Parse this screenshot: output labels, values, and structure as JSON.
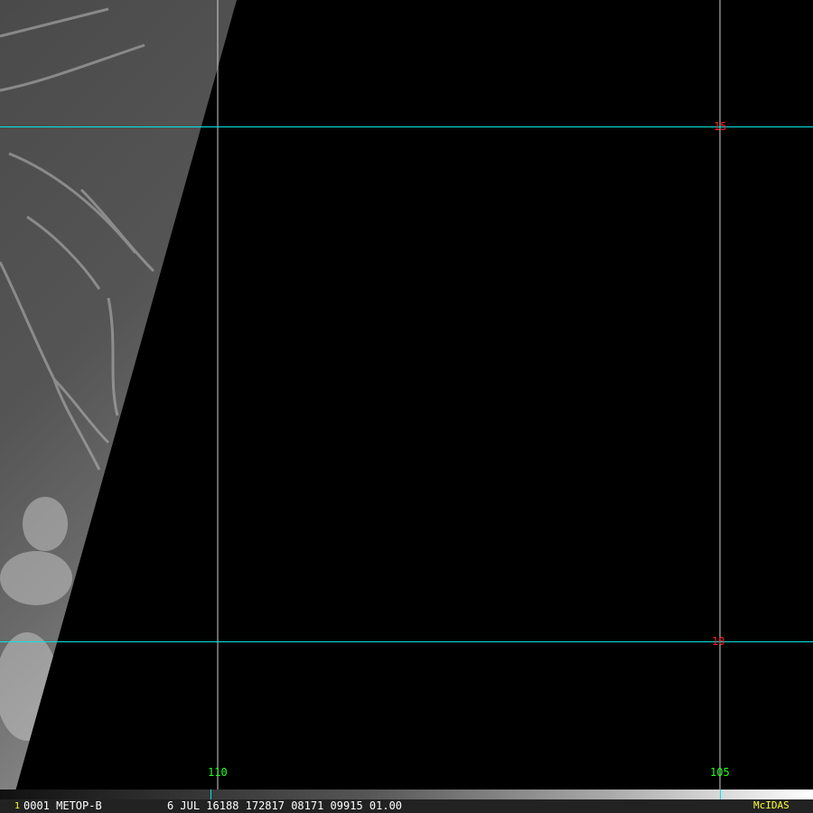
{
  "grid": {
    "latitude_labels": [
      "15",
      "10"
    ],
    "longitude_labels": [
      "110",
      "105"
    ],
    "lat_line_color": "#00e5e5",
    "lon_line_color": "#d0d0d0"
  },
  "status_bar": {
    "frame_number": "1",
    "text": "0001 METOP-B          6 JUL 16188 172817 08171 09915 01.00",
    "brand": "McIDAS"
  }
}
